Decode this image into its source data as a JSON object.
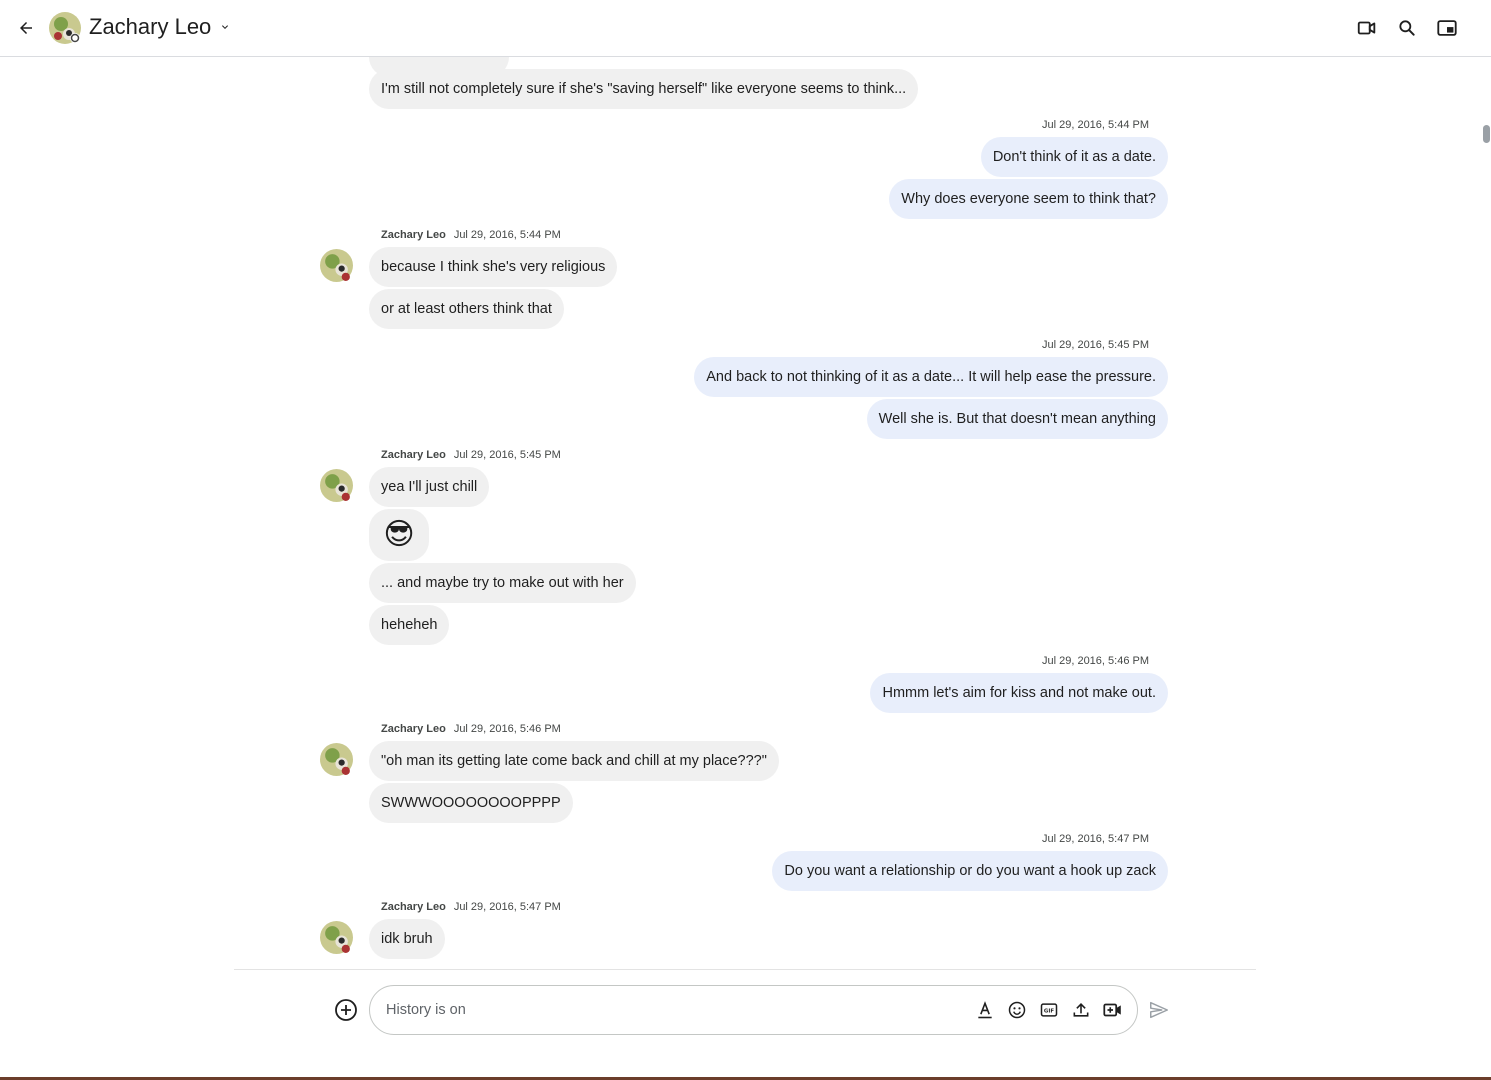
{
  "header": {
    "title": "Zachary Leo",
    "icons": [
      "back-arrow-icon",
      "chevron-down-icon",
      "video-call-icon",
      "search-icon",
      "picture-in-picture-icon"
    ]
  },
  "messages": {
    "partial_top": "I'm still not completely sure if she's \"saving herself\" like everyone seems to think...",
    "group1": {
      "time": "Jul 29, 2016, 5:44 PM",
      "items": [
        "Don't think of it as a date.",
        "Why does everyone seem to think that?"
      ]
    },
    "group2": {
      "sender": "Zachary Leo",
      "time": "Jul 29, 2016, 5:44 PM",
      "items": [
        "because I think she's very religious",
        "or at least others think that"
      ]
    },
    "group3": {
      "time": "Jul 29, 2016, 5:45 PM",
      "items": [
        "And back to not thinking of it as a date... It will help ease the pressure.",
        "Well she is. But that doesn't mean anything"
      ]
    },
    "group4": {
      "sender": "Zachary Leo",
      "time": "Jul 29, 2016, 5:45 PM",
      "items": [
        "yea I'll just chill",
        "😎",
        "... and maybe try to make out with her",
        "heheheh"
      ]
    },
    "group5": {
      "time": "Jul 29, 2016, 5:46 PM",
      "items": [
        "Hmmm let's aim for kiss and not make out."
      ]
    },
    "group6": {
      "sender": "Zachary Leo",
      "time": "Jul 29, 2016, 5:46 PM",
      "items": [
        "\"oh man its getting late come back and chill at my place???\"",
        "SWWWOOOOOOOOPPPP"
      ]
    },
    "group7": {
      "time": "Jul 29, 2016, 5:47 PM",
      "items": [
        "Do you want a relationship or do you want a hook up zack"
      ]
    },
    "group8": {
      "sender": "Zachary Leo",
      "time": "Jul 29, 2016, 5:47 PM",
      "items": [
        "idk bruh"
      ]
    }
  },
  "composer": {
    "placeholder": "History is on",
    "icons": [
      "add-icon",
      "text-format-icon",
      "emoji-icon",
      "gif-icon",
      "upload-icon",
      "video-add-icon",
      "send-icon"
    ]
  },
  "colors": {
    "incoming_bubble": "#f0f0f0",
    "outgoing_bubble": "#e8eefb",
    "frame": "#6b3d2a"
  }
}
